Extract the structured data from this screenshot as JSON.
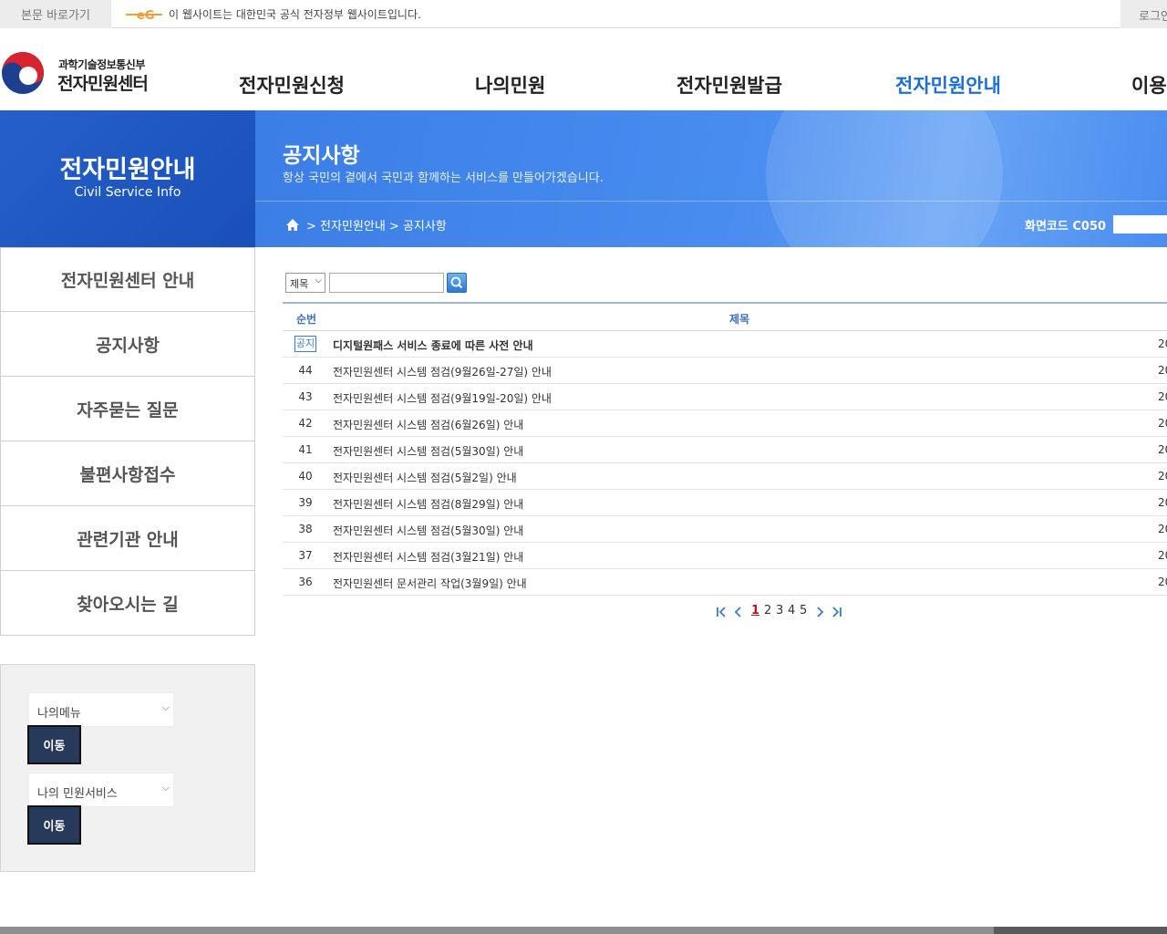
{
  "topbar": {
    "skip_link": "본문 바로가기",
    "gov_notice": "이 웹사이트는 대한민국 공식 전자정부 웹사이트입니다.",
    "login": "로그인"
  },
  "header": {
    "ministry": "과학기술정보통신부",
    "site_name": "전자민원센터",
    "gnb": [
      {
        "label": "전자민원신청"
      },
      {
        "label": "나의민원"
      },
      {
        "label": "전자민원발급"
      },
      {
        "label": "전자민원안내"
      },
      {
        "label": "이용안내"
      }
    ],
    "active_color": "#1b6fd6"
  },
  "side": {
    "title": "전자민원안내",
    "subtitle": "Civil Service Info",
    "menu": [
      {
        "label": "전자민원센터 안내"
      },
      {
        "label": "공지사항"
      },
      {
        "label": "자주묻는 질문"
      },
      {
        "label": "불편사항접수"
      },
      {
        "label": "관련기관 안내"
      },
      {
        "label": "찾아오시는 길"
      }
    ],
    "quick": {
      "select1": "나의메뉴",
      "button1": "이동",
      "select2": "나의 민원서비스",
      "button2": "이동"
    }
  },
  "banner": {
    "title": "공지사항",
    "description": "항상 국민의 곁에서 국민과 함께하는 서비스를 만들어가겠습니다.",
    "breadcrumb": "> 전자민원안내 > 공지사항",
    "screen_code": "화면코드 C050"
  },
  "search": {
    "field_selected": "제목",
    "query": ""
  },
  "table": {
    "headers": {
      "num": "순번",
      "title": "제목"
    },
    "notice_badge": "공지",
    "rows": [
      {
        "num": "",
        "title": "디지털원패스 서비스 종료에 따른 사전 안내",
        "date": "20",
        "notice": true
      },
      {
        "num": "44",
        "title": "전자민원센터 시스템 점검(9월26일-27일) 안내",
        "date": "20"
      },
      {
        "num": "43",
        "title": "전자민원센터 시스템 점검(9월19일-20일) 안내",
        "date": "20"
      },
      {
        "num": "42",
        "title": "전자민원센터 시스템 점검(6월26일) 안내",
        "date": "20"
      },
      {
        "num": "41",
        "title": "전자민원센터 시스템 점검(5월30일) 안내",
        "date": "20"
      },
      {
        "num": "40",
        "title": "전자민원센터 시스템 점검(5월2일) 안내",
        "date": "20"
      },
      {
        "num": "39",
        "title": "전자민원센터 시스템 점검(8월29일) 안내",
        "date": "20"
      },
      {
        "num": "38",
        "title": "전자민원센터 시스템 점검(5월30일) 안내",
        "date": "20"
      },
      {
        "num": "37",
        "title": "전자민원센터 시스템 점검(3월21일) 안내",
        "date": "20"
      },
      {
        "num": "36",
        "title": "전자민원센터 문서관리 작업(3월9일) 안내",
        "date": "20"
      }
    ]
  },
  "pagination": {
    "pages": [
      "1",
      "2",
      "3",
      "4",
      "5"
    ],
    "current": "1"
  }
}
